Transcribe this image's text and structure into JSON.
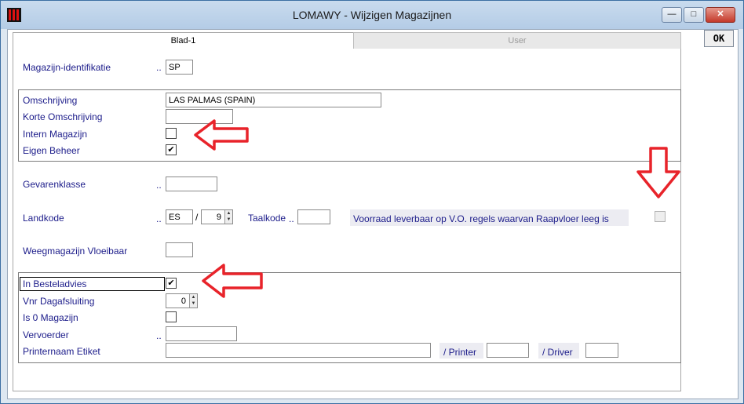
{
  "window": {
    "title": "LOMAWY - Wijzigen Magazijnen",
    "btn_min": "—",
    "btn_max": "□",
    "btn_close": "✕"
  },
  "toolbar": {
    "ok_label": "OK"
  },
  "tabs": [
    {
      "label": "Blad-1"
    },
    {
      "label": "User"
    }
  ],
  "form": {
    "dots": "..",
    "magazijn_id": {
      "label": "Magazijn-identifikatie",
      "value": "SP"
    },
    "omschrijving": {
      "label": "Omschrijving",
      "value": "LAS PALMAS (SPAIN)"
    },
    "korte_omschrijving": {
      "label": "Korte Omschrijving",
      "value": ""
    },
    "intern_magazijn": {
      "label": "Intern Magazijn",
      "checked": false
    },
    "eigen_beheer": {
      "label": "Eigen Beheer",
      "checked": true,
      "mark": "✔"
    },
    "gevarenklasse": {
      "label": "Gevarenklasse",
      "value": ""
    },
    "landkode": {
      "label": "Landkode",
      "value": "ES",
      "sep": "/",
      "sub_value": "9"
    },
    "taalkode": {
      "label": "Taalkode",
      "value": ""
    },
    "voorraad": {
      "label": "Voorraad leverbaar op V.O. regels waarvan Raapvloer leeg is",
      "checked": false
    },
    "weegmagazijn": {
      "label": "Weegmagazijn Vloeibaar",
      "value": ""
    },
    "in_besteladvies": {
      "label": "In Besteladvies",
      "checked": true,
      "mark": "✔"
    },
    "vnr_dagafsluiting": {
      "label": "Vnr Dagafsluiting",
      "value": "0"
    },
    "is0_magazijn": {
      "label": "Is 0 Magazijn",
      "checked": false
    },
    "vervoerder": {
      "label": "Vervoerder",
      "value": ""
    },
    "printernaam": {
      "label": "Printernaam Etiket",
      "value": ""
    },
    "printer": {
      "label": "/ Printer",
      "value": ""
    },
    "driver": {
      "label": "/ Driver",
      "value": ""
    }
  },
  "spin": {
    "up": "▲",
    "down": "▼"
  },
  "colors": {
    "annotation_arrow": "#e8232a",
    "label_text": "#1c1c8a"
  }
}
